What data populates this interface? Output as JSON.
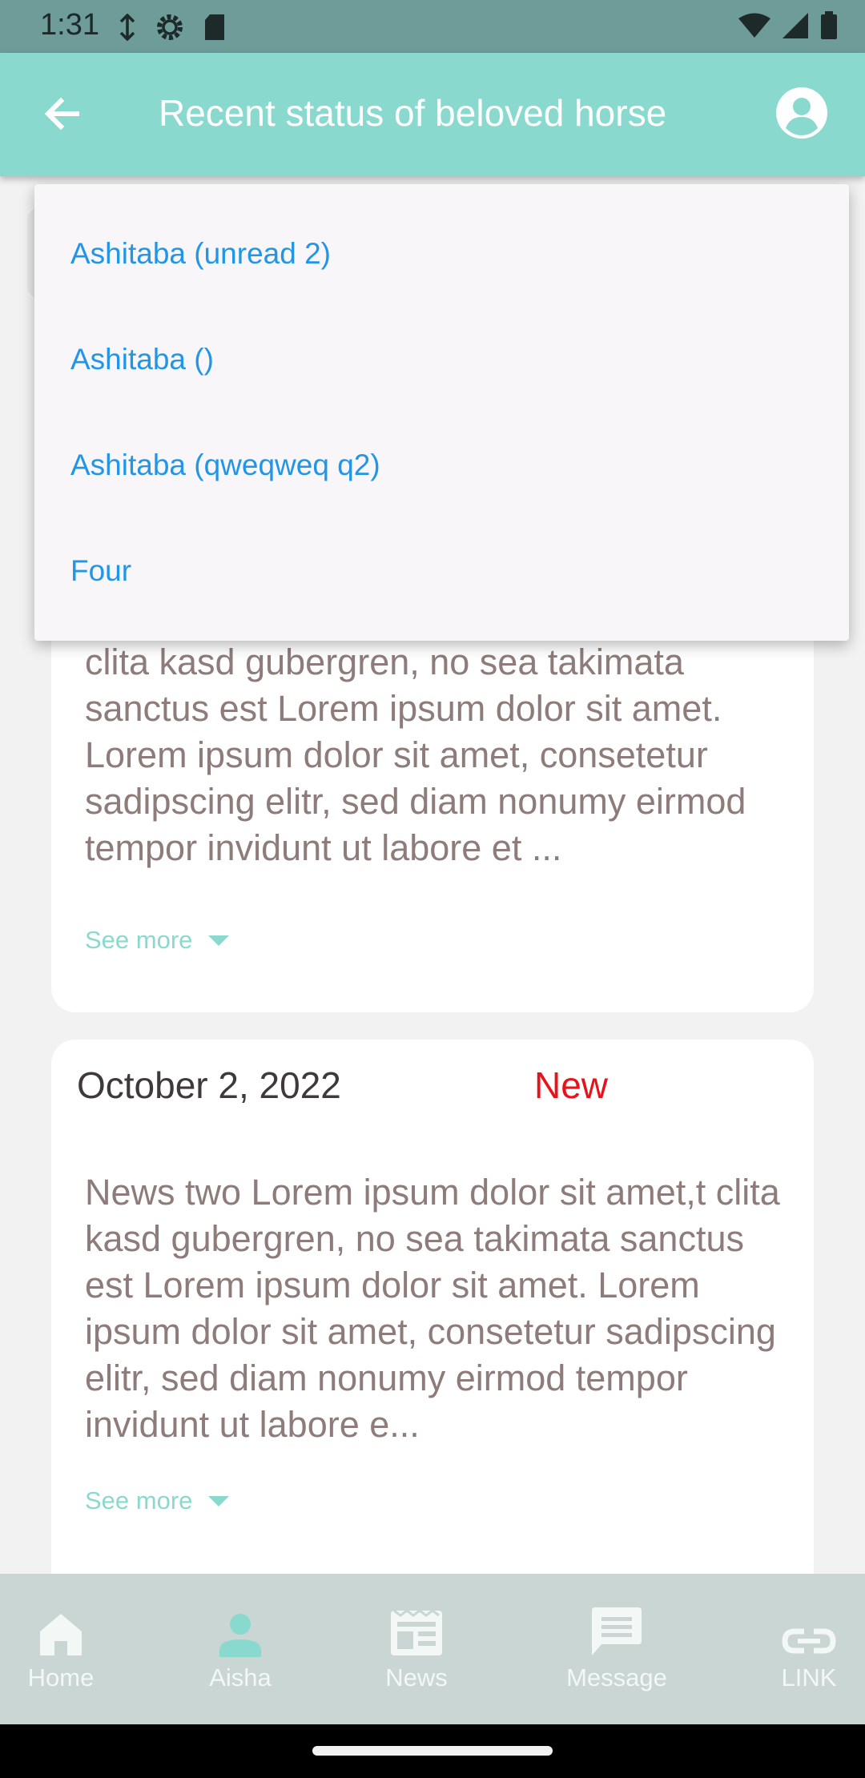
{
  "status_bar": {
    "time": "1:31"
  },
  "app_bar": {
    "title": "Recent status of beloved horse"
  },
  "dropdown": {
    "options": [
      "Ashitaba (unread 2)",
      "Ashitaba ()",
      "Ashitaba (qweqweq q2)",
      "Four"
    ]
  },
  "cards": [
    {
      "text": "clita kasd gubergren, no sea takimata sanctus est Lorem ipsum dolor sit amet. Lorem ipsum dolor sit amet, consetetur sadipscing elitr, sed diam nonumy eirmod tempor invidunt ut labore et ...",
      "see_more": "See more"
    },
    {
      "date": "October 2, 2022",
      "badge": "New",
      "text": "News two Lorem ipsum dolor sit amet,t clita kasd gubergren, no sea takimata sanctus est Lorem ipsum dolor sit amet. Lorem ipsum dolor sit amet, consetetur sadipscing elitr, sed diam nonumy eirmod tempor invidunt ut labore e...",
      "see_more": "See more"
    }
  ],
  "bottom_nav": {
    "items": [
      {
        "label": "Home",
        "icon": "home-icon"
      },
      {
        "label": "Aisha",
        "icon": "person-icon"
      },
      {
        "label": "News",
        "icon": "news-icon"
      },
      {
        "label": "Message",
        "icon": "message-icon"
      },
      {
        "label": "LINK",
        "icon": "link-icon"
      }
    ],
    "active_index": 1
  },
  "colors": {
    "app_bar": "#8ad9cf",
    "accent": "#8ad9cf",
    "option_text": "#2196e6",
    "new_badge": "#e8121b"
  }
}
